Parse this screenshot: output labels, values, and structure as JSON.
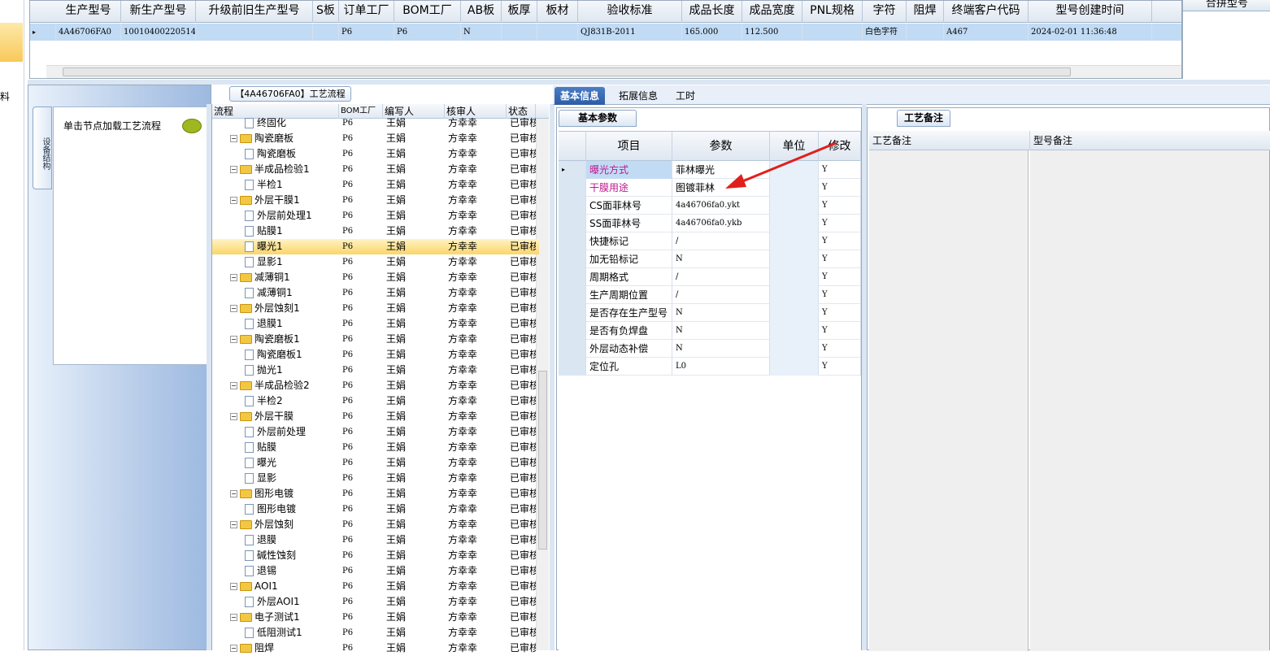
{
  "left_strip": {
    "char": "料"
  },
  "top_grid": {
    "headers": [
      "生产型号",
      "新生产型号",
      "升级前旧生产型号",
      "S板",
      "订单工厂",
      "BOM工厂",
      "AB板",
      "板厚",
      "板材",
      "验收标准",
      "成品长度",
      "成品宽度",
      "PNL规格",
      "字符",
      "阻焊",
      "终端客户代码",
      "型号创建时间"
    ],
    "row": [
      "4A46706FA0",
      "10010400220514",
      "",
      "",
      "P6",
      "P6",
      "N",
      "",
      "",
      "QJ831B-2011",
      "165.000",
      "112.500",
      "",
      "白色字符",
      "",
      "A467",
      "2024-02-01 11:36:48"
    ],
    "row_marker": "▸"
  },
  "right_top": {
    "header": "合拼型号"
  },
  "left_panel": {
    "side_tab": "设备结构",
    "button_label": "单击节点加载工艺流程"
  },
  "process": {
    "title": "【4A46706FA0】工艺流程",
    "headers": [
      "流程",
      "BOM工厂",
      "编写人",
      "核审人",
      "状态"
    ],
    "rows": [
      {
        "name": "终固化",
        "level": 2,
        "factory": "P6",
        "writer": "王娟",
        "reviewer": "方幸幸",
        "status": "已审核"
      },
      {
        "name": "陶瓷磨板",
        "level": 1,
        "factory": "P6",
        "writer": "王娟",
        "reviewer": "方幸幸",
        "status": "已审核"
      },
      {
        "name": "陶瓷磨板",
        "level": 2,
        "factory": "P6",
        "writer": "王娟",
        "reviewer": "方幸幸",
        "status": "已审核"
      },
      {
        "name": "半成品检验1",
        "level": 1,
        "factory": "P6",
        "writer": "王娟",
        "reviewer": "方幸幸",
        "status": "已审核"
      },
      {
        "name": "半检1",
        "level": 2,
        "factory": "P6",
        "writer": "王娟",
        "reviewer": "方幸幸",
        "status": "已审核"
      },
      {
        "name": "外层干膜1",
        "level": 1,
        "factory": "P6",
        "writer": "王娟",
        "reviewer": "方幸幸",
        "status": "已审核"
      },
      {
        "name": "外层前处理1",
        "level": 2,
        "factory": "P6",
        "writer": "王娟",
        "reviewer": "方幸幸",
        "status": "已审核"
      },
      {
        "name": "贴膜1",
        "level": 2,
        "factory": "P6",
        "writer": "王娟",
        "reviewer": "方幸幸",
        "status": "已审核"
      },
      {
        "name": "曝光1",
        "level": 2,
        "factory": "P6",
        "writer": "王娟",
        "reviewer": "方幸幸",
        "status": "已审核",
        "selected": true
      },
      {
        "name": "显影1",
        "level": 2,
        "factory": "P6",
        "writer": "王娟",
        "reviewer": "方幸幸",
        "status": "已审核"
      },
      {
        "name": "减薄铜1",
        "level": 1,
        "factory": "P6",
        "writer": "王娟",
        "reviewer": "方幸幸",
        "status": "已审核"
      },
      {
        "name": "减薄铜1",
        "level": 2,
        "factory": "P6",
        "writer": "王娟",
        "reviewer": "方幸幸",
        "status": "已审核"
      },
      {
        "name": "外层蚀刻1",
        "level": 1,
        "factory": "P6",
        "writer": "王娟",
        "reviewer": "方幸幸",
        "status": "已审核"
      },
      {
        "name": "退膜1",
        "level": 2,
        "factory": "P6",
        "writer": "王娟",
        "reviewer": "方幸幸",
        "status": "已审核"
      },
      {
        "name": "陶瓷磨板1",
        "level": 1,
        "factory": "P6",
        "writer": "王娟",
        "reviewer": "方幸幸",
        "status": "已审核"
      },
      {
        "name": "陶瓷磨板1",
        "level": 2,
        "factory": "P6",
        "writer": "王娟",
        "reviewer": "方幸幸",
        "status": "已审核"
      },
      {
        "name": "抛光1",
        "level": 2,
        "factory": "P6",
        "writer": "王娟",
        "reviewer": "方幸幸",
        "status": "已审核"
      },
      {
        "name": "半成品检验2",
        "level": 1,
        "factory": "P6",
        "writer": "王娟",
        "reviewer": "方幸幸",
        "status": "已审核"
      },
      {
        "name": "半检2",
        "level": 2,
        "factory": "P6",
        "writer": "王娟",
        "reviewer": "方幸幸",
        "status": "已审核"
      },
      {
        "name": "外层干膜",
        "level": 1,
        "factory": "P6",
        "writer": "王娟",
        "reviewer": "方幸幸",
        "status": "已审核"
      },
      {
        "name": "外层前处理",
        "level": 2,
        "factory": "P6",
        "writer": "王娟",
        "reviewer": "方幸幸",
        "status": "已审核"
      },
      {
        "name": "贴膜",
        "level": 2,
        "factory": "P6",
        "writer": "王娟",
        "reviewer": "方幸幸",
        "status": "已审核"
      },
      {
        "name": "曝光",
        "level": 2,
        "factory": "P6",
        "writer": "王娟",
        "reviewer": "方幸幸",
        "status": "已审核"
      },
      {
        "name": "显影",
        "level": 2,
        "factory": "P6",
        "writer": "王娟",
        "reviewer": "方幸幸",
        "status": "已审核"
      },
      {
        "name": "图形电镀",
        "level": 1,
        "factory": "P6",
        "writer": "王娟",
        "reviewer": "方幸幸",
        "status": "已审核"
      },
      {
        "name": "图形电镀",
        "level": 2,
        "factory": "P6",
        "writer": "王娟",
        "reviewer": "方幸幸",
        "status": "已审核"
      },
      {
        "name": "外层蚀刻",
        "level": 1,
        "factory": "P6",
        "writer": "王娟",
        "reviewer": "方幸幸",
        "status": "已审核"
      },
      {
        "name": "退膜",
        "level": 2,
        "factory": "P6",
        "writer": "王娟",
        "reviewer": "方幸幸",
        "status": "已审核"
      },
      {
        "name": "碱性蚀刻",
        "level": 2,
        "factory": "P6",
        "writer": "王娟",
        "reviewer": "方幸幸",
        "status": "已审核"
      },
      {
        "name": "退锡",
        "level": 2,
        "factory": "P6",
        "writer": "王娟",
        "reviewer": "方幸幸",
        "status": "已审核"
      },
      {
        "name": "AOI1",
        "level": 1,
        "factory": "P6",
        "writer": "王娟",
        "reviewer": "方幸幸",
        "status": "已审核"
      },
      {
        "name": "外层AOI1",
        "level": 2,
        "factory": "P6",
        "writer": "王娟",
        "reviewer": "方幸幸",
        "status": "已审核"
      },
      {
        "name": "电子测试1",
        "level": 1,
        "factory": "P6",
        "writer": "王娟",
        "reviewer": "方幸幸",
        "status": "已审核"
      },
      {
        "name": "低阻测试1",
        "level": 2,
        "factory": "P6",
        "writer": "王娟",
        "reviewer": "方幸幸",
        "status": "已审核"
      },
      {
        "name": "阻焊",
        "level": 1,
        "factory": "P6",
        "writer": "王娟",
        "reviewer": "方幸幸",
        "status": "已审核"
      }
    ]
  },
  "tabs": [
    "基本信息",
    "拓展信息",
    "工时"
  ],
  "basic": {
    "tab_label": "基本参数",
    "headers": [
      "项目",
      "参数",
      "单位",
      "修改"
    ],
    "rows": [
      {
        "item": "曝光方式",
        "param": "菲林曝光",
        "unit": "",
        "edit": "Y",
        "highlight": true,
        "selected": true
      },
      {
        "item": "干膜用途",
        "param": "图镀菲林",
        "unit": "",
        "edit": "Y",
        "highlight": true
      },
      {
        "item": "CS面菲林号",
        "param": "4a46706fa0.ykt",
        "unit": "",
        "edit": "Y"
      },
      {
        "item": "SS面菲林号",
        "param": "4a46706fa0.ykb",
        "unit": "",
        "edit": "Y"
      },
      {
        "item": "快捷标记",
        "param": "/",
        "unit": "",
        "edit": "Y"
      },
      {
        "item": "加无铅标记",
        "param": "N",
        "unit": "",
        "edit": "Y"
      },
      {
        "item": "周期格式",
        "param": "/",
        "unit": "",
        "edit": "Y"
      },
      {
        "item": "生产周期位置",
        "param": "/",
        "unit": "",
        "edit": "Y"
      },
      {
        "item": "是否存在生产型号",
        "param": "N",
        "unit": "",
        "edit": "Y"
      },
      {
        "item": "是否有负焊盘",
        "param": "N",
        "unit": "",
        "edit": "Y"
      },
      {
        "item": "外层动态补偿",
        "param": "N",
        "unit": "",
        "edit": "Y"
      },
      {
        "item": "定位孔",
        "param": "L0",
        "unit": "",
        "edit": "Y"
      }
    ]
  },
  "remarks": {
    "tab_label": "工艺备注",
    "headers": [
      "工艺备注",
      "型号备注"
    ]
  },
  "colors": {
    "accent": "#2d5ca6",
    "selection": "#c2dbf5",
    "highlight_text": "#c0178f",
    "arrow": "#e0201c"
  }
}
